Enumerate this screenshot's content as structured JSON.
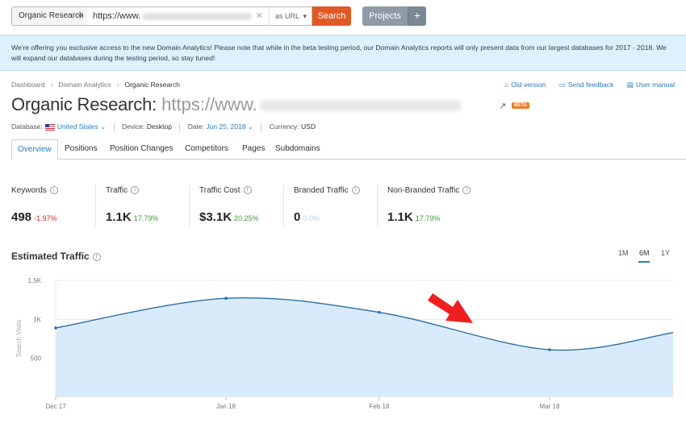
{
  "search": {
    "database_select": "Organic Research",
    "url_value": "https://www.",
    "mode": "as URL",
    "search_label": "Search",
    "projects_label": "Projects",
    "projects_add": "+"
  },
  "notice": {
    "text": "We're offering you exclusive access to the new Domain Analytics! Please note that while in the beta testing period, our Domain Analytics reports will only present data from our largest databases for 2017 - 2018. We will expand our databases during the testing period, so stay tuned!"
  },
  "breadcrumb": [
    "Dashboard",
    "Domain Analytics",
    "Organic Research"
  ],
  "top_links": {
    "old_version": "Old version",
    "send_feedback": "Send feedback",
    "user_manual": "User manual"
  },
  "title": {
    "prefix": "Organic Research:",
    "url": "https://www.",
    "badge": "BETA"
  },
  "meta": {
    "database_label": "Database:",
    "database_value": "United States",
    "device_label": "Device:",
    "device_value": "Desktop",
    "date_label": "Date:",
    "date_value": "Jun 25, 2018",
    "currency_label": "Currency:",
    "currency_value": "USD"
  },
  "tabs": [
    "Overview",
    "Positions",
    "Position Changes",
    "Competitors",
    "Pages",
    "Subdomains"
  ],
  "kpis": [
    {
      "label": "Keywords",
      "value": "498",
      "delta": "-1.97%",
      "delta_color": "#d9262c"
    },
    {
      "label": "Traffic",
      "value": "1.1K",
      "delta": "17.79%",
      "delta_color": "#3f9c35"
    },
    {
      "label": "Traffic Cost",
      "value": "$3.1K",
      "delta": "20.25%",
      "delta_color": "#3f9c35"
    },
    {
      "label": "Branded Traffic",
      "value": "0",
      "delta": "0.0%",
      "delta_color": "#b5d3ea"
    },
    {
      "label": "Non-Branded Traffic",
      "value": "1.1K",
      "delta": "17.79%",
      "delta_color": "#3f9c35"
    }
  ],
  "chart_section": {
    "title": "Estimated Traffic",
    "ranges": [
      "1M",
      "6M",
      "1Y"
    ],
    "active_range": "6M"
  },
  "chart_data": {
    "type": "area",
    "ylabel": "Search Visits",
    "yticks": [
      "1.5K",
      "1K",
      "500"
    ],
    "ylim": [
      0,
      1500
    ],
    "xticks": [
      "Dec 17",
      "Jan 18",
      "Feb 18",
      "Mar 18"
    ],
    "series": [
      {
        "values": [
          {
            "x": "Dec 17",
            "y": 890
          },
          {
            "x": "Jan 18",
            "y": 1270
          },
          {
            "x": "Feb 18",
            "y": 1090
          },
          {
            "x": "Mar 18",
            "y": 610
          },
          {
            "x": "Apr 18",
            "y": 830
          }
        ]
      }
    ],
    "line_color": "#2b6ea8",
    "fill_color": "#d9ebfa",
    "annotation_color": "#f01e1e"
  }
}
